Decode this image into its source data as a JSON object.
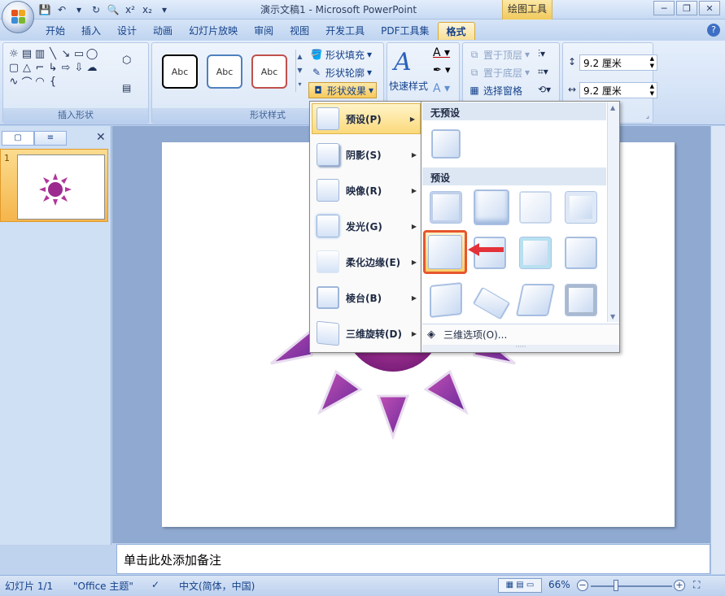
{
  "title_bar": {
    "title": "演示文稿1 - Microsoft PowerPoint",
    "contextual_tab": "绘图工具",
    "quick_access": [
      "save",
      "undo",
      "repeat",
      "print-preview",
      "superscript",
      "subscript"
    ]
  },
  "tabs": [
    "开始",
    "插入",
    "设计",
    "动画",
    "幻灯片放映",
    "审阅",
    "视图",
    "开发工具",
    "PDF工具集",
    "格式"
  ],
  "active_tab": "格式",
  "ribbon": {
    "insert_shapes_label": "插入形状",
    "shape_styles_label": "形状样式",
    "style_sample_text": "Abc",
    "shape_fill": "形状填充",
    "shape_outline": "形状轮廓",
    "shape_effects": "形状效果",
    "quick_styles": "快速样式",
    "bring_front": "置于顶层",
    "send_back": "置于底层",
    "selection_pane": "选择窗格",
    "height_value": "9.2 厘米",
    "width_value": "9.2 厘米"
  },
  "effects_menu": {
    "items": [
      {
        "label": "预设(P)",
        "key": "preset"
      },
      {
        "label": "阴影(S)",
        "key": "shadow"
      },
      {
        "label": "映像(R)",
        "key": "reflection"
      },
      {
        "label": "发光(G)",
        "key": "glow"
      },
      {
        "label": "柔化边缘(E)",
        "key": "soft-edges"
      },
      {
        "label": "棱台(B)",
        "key": "bevel"
      },
      {
        "label": "三维旋转(D)",
        "key": "3d-rotation"
      }
    ],
    "hovered": "preset"
  },
  "preset_submenu": {
    "no_preset_header": "无预设",
    "preset_header": "预设",
    "options_label": "三维选项(O)..."
  },
  "slides_pane": {
    "slide_number": "1"
  },
  "notes_placeholder": "单击此处添加备注",
  "status_bar": {
    "slide_info": "幻灯片 1/1",
    "theme": "\"Office 主题\"",
    "language": "中文(简体，中国)",
    "zoom": "66%"
  },
  "colors": {
    "sun_body": "#9c2a8f",
    "sun_rays": "#7a2a8c",
    "ribbon_bg": "#d6e4f7",
    "hover_gold": "#fbd97b",
    "highlight_red": "#e6562e"
  }
}
